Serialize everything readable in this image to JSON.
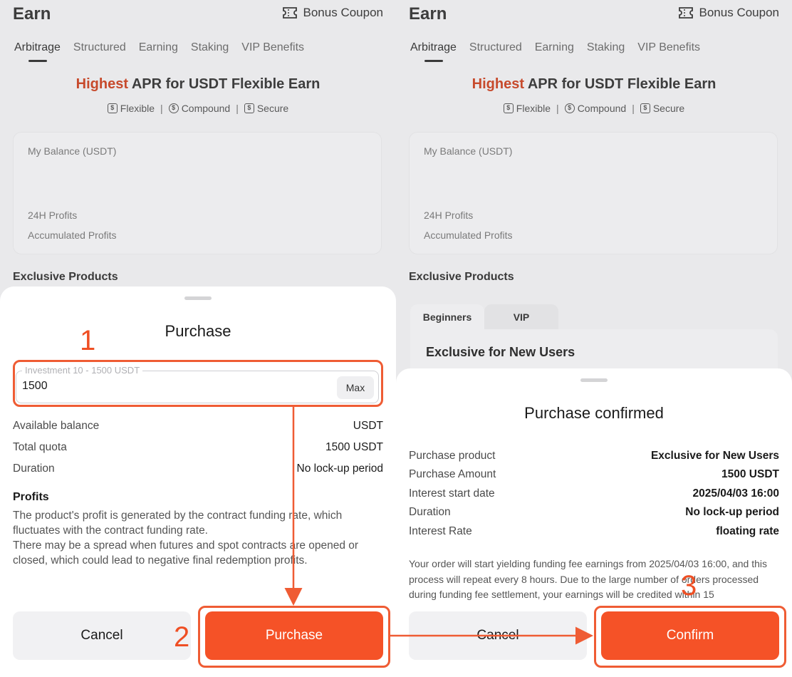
{
  "background": {
    "app_title": "Earn",
    "bonus_coupon_label": "Bonus Coupon",
    "tabs": [
      "Arbitrage",
      "Structured",
      "Earning",
      "Staking",
      "VIP Benefits"
    ],
    "active_tab": "Arbitrage",
    "headline_highlight": "Highest",
    "headline_rest": " APR for USDT Flexible Earn",
    "features": [
      {
        "icon": "flexible-icon",
        "label": "Flexible"
      },
      {
        "icon": "compound-icon",
        "label": "Compound"
      },
      {
        "icon": "secure-icon",
        "label": "Secure"
      }
    ],
    "balance_label": "My Balance (USDT)",
    "profits_24h_label": "24H Profits",
    "accumulated_profits_label": "Accumulated Profits",
    "exclusive_products_label": "Exclusive Products",
    "product_tabs": [
      "Beginners",
      "VIP"
    ],
    "product_card_title": "Exclusive for New Users"
  },
  "purchase_sheet": {
    "title": "Purchase",
    "investment_label": "Investment 10 - 1500 USDT",
    "investment_value": "1500",
    "max_label": "Max",
    "rows": [
      {
        "label": "Available balance",
        "value": "USDT"
      },
      {
        "label": "Total quota",
        "value": "1500 USDT"
      },
      {
        "label": "Duration",
        "value": "No lock-up period"
      }
    ],
    "profits_title": "Profits",
    "profits_text_1": "The product's profit is generated by the contract funding rate, which fluctuates with the contract funding rate.",
    "profits_text_2": "There may be a spread when futures and spot contracts are opened or closed, which could lead to negative final redemption profits.",
    "cancel_label": "Cancel",
    "purchase_label": "Purchase"
  },
  "confirm_sheet": {
    "title": "Purchase confirmed",
    "rows": [
      {
        "label": "Purchase product",
        "value": "Exclusive for New Users"
      },
      {
        "label": "Purchase Amount",
        "value": "1500 USDT"
      },
      {
        "label": "Interest start date",
        "value": "2025/04/03 16:00"
      },
      {
        "label": "Duration",
        "value": "No lock-up period"
      },
      {
        "label": "Interest Rate",
        "value": "floating rate"
      }
    ],
    "notice": "Your order will start yielding funding fee earnings from 2025/04/03 16:00, and this process will repeat every 8 hours. Due to the large number of orders processed during funding fee settlement, your earnings will be credited within 15",
    "cancel_label": "Cancel",
    "confirm_label": "Confirm"
  },
  "annotations": {
    "steps": [
      "1",
      "2",
      "3"
    ],
    "color": "#ef5c34"
  }
}
